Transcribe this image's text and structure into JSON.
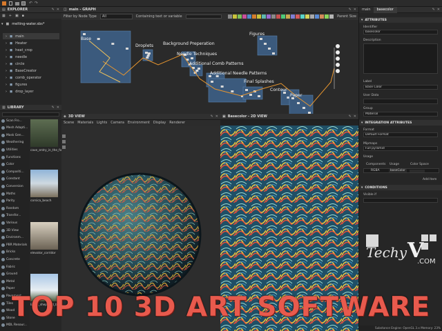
{
  "menubar": {
    "icons": [
      "app-icon",
      "new-icon",
      "open-icon",
      "save-icon",
      "undo-icon",
      "redo-icon",
      "more-icon"
    ]
  },
  "explorer": {
    "title": "EXPLORER",
    "file": "melting-water.sbs*",
    "items": [
      "main",
      "Heater",
      "heat_crop",
      "needle",
      "circle",
      "BaseCreator",
      "comb_operator",
      "figures",
      "drop_layer"
    ]
  },
  "graph": {
    "title": "main - GRAPH",
    "filter_label": "Filter by Node Type",
    "filter_value": "All",
    "containing_label": "Containing text or variable",
    "parent_size": "Parent Size",
    "frames": [
      "Base",
      "Droplets",
      "Background Preperation",
      "Needle Techniques",
      "Additional Comb Patterns",
      "Additional Needle Patterns",
      "Final Splashes",
      "Contour",
      "Paper",
      "Figures"
    ]
  },
  "library": {
    "title": "LIBRARY",
    "categories": [
      "Scan Fro...",
      "Mesh Adapti...",
      "Mask Gen...",
      "Weathering",
      "Utilities",
      "Functions",
      "Color",
      "Compariti...",
      "Constant",
      "Conversion",
      "Maths",
      "Parity",
      "Random",
      "Transfor...",
      "Various",
      "3D View",
      "Environm...",
      "PBR Materials",
      "Bricks",
      "Concrete",
      "Fabric",
      "Ground",
      "Metal",
      "Paper",
      "Pavement",
      "Tiles",
      "Wood",
      "Stone",
      "MDL Resour..."
    ],
    "thumbs": [
      "cave_entry_in_the_for...",
      "corsica_beach",
      "elevator_corridor",
      "Ennis_sheppard_bu..."
    ]
  },
  "view3d": {
    "title": "3D VIEW",
    "menu": [
      "Scene",
      "Materials",
      "Lights",
      "Camera",
      "Environment",
      "Display",
      "Renderer"
    ]
  },
  "view2d": {
    "title": "Basecolor - 2D VIEW"
  },
  "properties": {
    "tabs": [
      "main",
      "basecolor"
    ],
    "attributes_title": "ATTRIBUTES",
    "identifier_label": "Identifier",
    "identifier_value": "basecolor",
    "description_label": "Description",
    "label_label": "Label",
    "label_value": "Base Color",
    "userdata_label": "User Data",
    "group_label": "Group",
    "group_value": "Material",
    "integration_title": "INTEGRATION ATTRIBUTES",
    "format_label": "Format",
    "format_value": "Default Format",
    "mipmaps_label": "Mipmaps",
    "mipmaps_value": "Full pyramid",
    "usage_label": "Usage",
    "components_label": "Components",
    "usage_col": "Usage",
    "colorspace_col": "Color Space",
    "components_value": "RGBA",
    "usage_value": "baseColor",
    "add_item": "Add Item",
    "conditions_title": "CONDITIONS",
    "visible_label": "Visible if",
    "status": "Substance Engine: OpenGL 3.x  Memory: 23%"
  },
  "watermark": {
    "brand": "Techy",
    "v": "V",
    "suffix": ".COM"
  },
  "headline": "TOP 10 3D ART SOFTWARE",
  "colors": {
    "accent_orange": "#e88a2a",
    "frame_blue": "#3c5878",
    "headline": "#e85a4d"
  }
}
